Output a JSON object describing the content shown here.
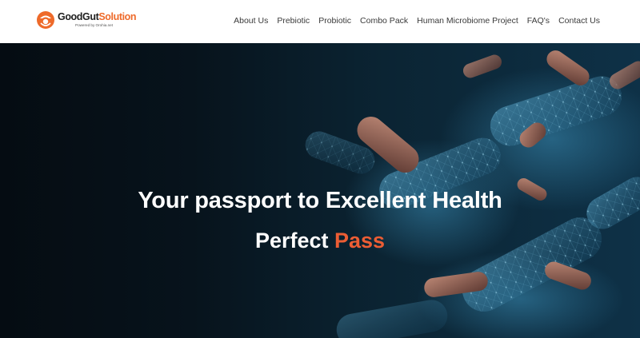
{
  "header": {
    "logo": {
      "name_part1": "GoodGut",
      "name_part2": "Solution",
      "tagline": "Powered by Orohia.net"
    },
    "nav": [
      {
        "label": "About Us"
      },
      {
        "label": "Prebiotic"
      },
      {
        "label": "Probiotic"
      },
      {
        "label": "Combo Pack"
      },
      {
        "label": "Human Microbiome Project"
      },
      {
        "label": "FAQ's"
      },
      {
        "label": "Contact Us"
      }
    ]
  },
  "hero": {
    "headline": "Your passport to Excellent Health",
    "subheadline_part1": "Perfect ",
    "subheadline_accent": "Pass"
  },
  "colors": {
    "brand_orange": "#ee6a2a",
    "accent": "#ec5d34",
    "hero_dark": "#050c12",
    "hero_blue": "#0e3147"
  },
  "icons": [
    "logo-mark-icon"
  ]
}
